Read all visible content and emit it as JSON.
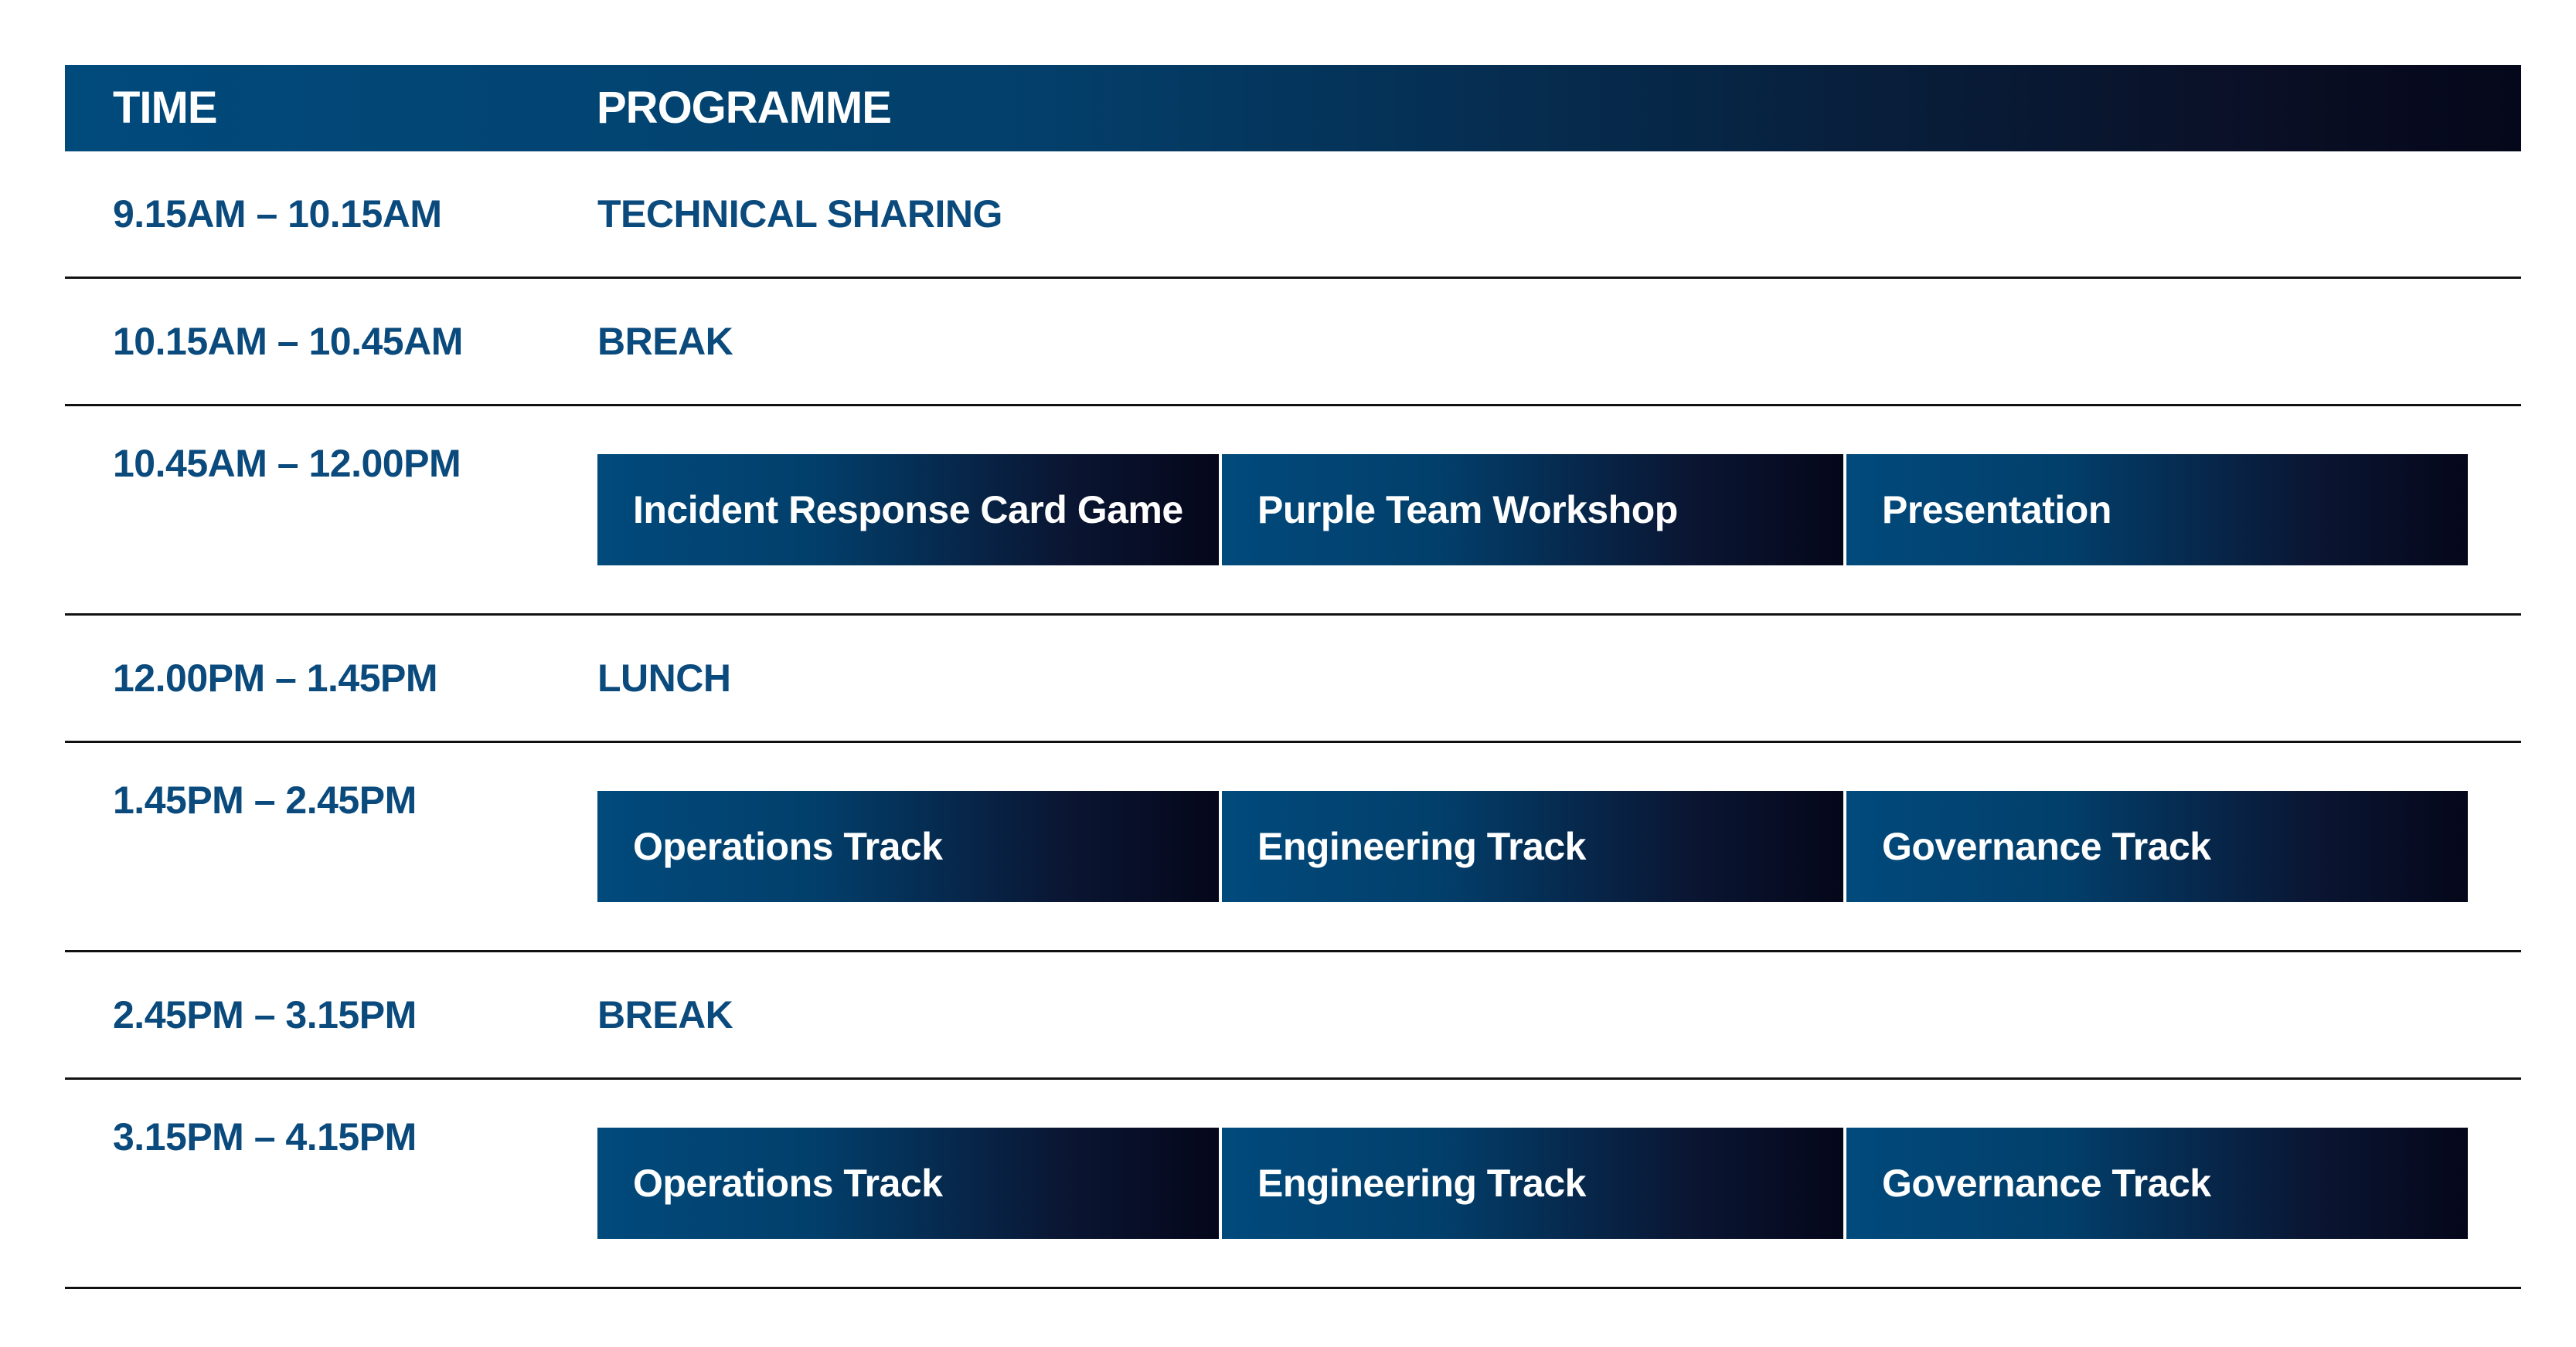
{
  "header": {
    "time_label": "TIME",
    "programme_label": "PROGRAMME"
  },
  "colors": {
    "header_start": "#014a7c",
    "header_end": "#05071a",
    "text_blue": "#0a4a7c",
    "divider": "#111111"
  },
  "rows": [
    {
      "time": "9.15AM – 10.15AM",
      "programme": "TECHNICAL SHARING"
    },
    {
      "time": "10.15AM – 10.45AM",
      "programme": "BREAK"
    },
    {
      "time": "10.45AM – 12.00PM",
      "tracks": [
        "Incident Response Card Game",
        "Purple Team Workshop",
        "Presentation"
      ]
    },
    {
      "time": "12.00PM – 1.45PM",
      "programme": "LUNCH"
    },
    {
      "time": "1.45PM – 2.45PM",
      "tracks": [
        "Operations Track",
        "Engineering Track",
        "Governance Track"
      ]
    },
    {
      "time": "2.45PM – 3.15PM",
      "programme": "BREAK"
    },
    {
      "time": "3.15PM – 4.15PM",
      "tracks": [
        "Operations Track",
        "Engineering Track",
        "Governance Track"
      ]
    }
  ]
}
